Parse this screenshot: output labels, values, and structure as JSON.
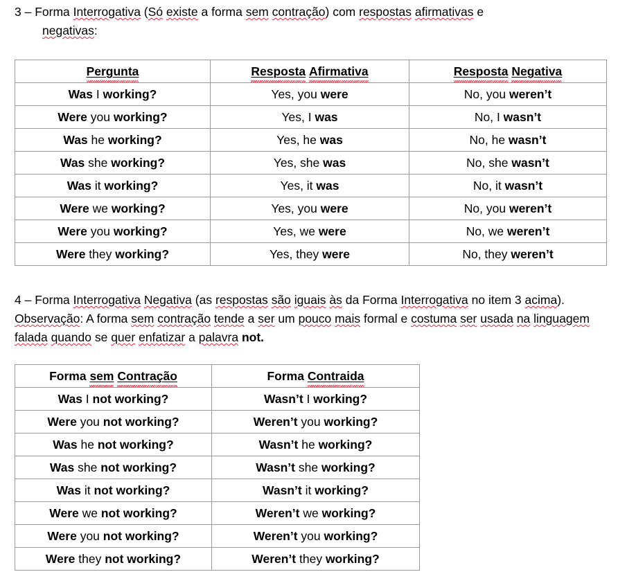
{
  "document": {
    "section3": {
      "number": "3",
      "dash": "–",
      "line1_part1": "Forma ",
      "line1_interrogativa": "Interrogativa",
      "line1_part2": " (",
      "line1_so": "Só",
      "line1_part3": " ",
      "line1_existe": "existe",
      "line1_part4": " a forma ",
      "line1_sem": "sem",
      "line1_part5": " ",
      "line1_contracao": "contração",
      "line1_part6": ") com ",
      "line1_respostas": "respostas",
      "line1_part7": " ",
      "line1_afirmativas": "afirmativas",
      "line1_part8": " e",
      "line2_negativas": "negativas",
      "line2_colon": ":"
    },
    "section4": {
      "number": "4",
      "dash": "–",
      "t1": "Forma ",
      "t2": "Interrogativa",
      "t3": " ",
      "t4": "Negativa",
      "t5": " (as ",
      "t6": "respostas",
      "t7": " ",
      "t8": "são",
      "t9": " ",
      "t10": "iguais",
      "t11": " ",
      "t12": "às",
      "t13": " da Forma ",
      "t14": "Interrogativa",
      "t15": " no item 3 ",
      "t16": "acima",
      "t17": "). ",
      "t18": "Observação",
      "t19": ": A forma ",
      "t20": "sem",
      "t21": " ",
      "t22": "contração",
      "t23": " ",
      "t24": "tende",
      "t25": " a ",
      "t26": "ser",
      "t27": " um ",
      "t28": "pouco",
      "t29": " ",
      "t30": "mais",
      "t31": " formal e ",
      "t32": "costuma",
      "t33": " ",
      "t34": "ser",
      "t35": " ",
      "t36": "usada",
      "t37": " ",
      "t38": "na",
      "t39": " ",
      "t40": "linguagem",
      "t41": " ",
      "t42": "falada",
      "t43": " ",
      "t44": "quando",
      "t45": " se ",
      "t46": "quer",
      "t47": " ",
      "t48": "enfatizar",
      "t49": " a ",
      "t50": "palavra",
      "t51": " ",
      "t52_bold": "not."
    }
  },
  "table_interrogative": {
    "headers": [
      {
        "word1": "Pergunta",
        "word2": ""
      },
      {
        "word1": "Resposta",
        "word2": "Afirmativa"
      },
      {
        "word1": "Resposta",
        "word2": "Negativa"
      }
    ],
    "rows": [
      {
        "q_bold": "Was",
        "q_mid": " I ",
        "q_tail_bold": "working?",
        "a_plain": "Yes, you ",
        "a_bold": "were",
        "n_plain": "No, you ",
        "n_bold": "weren’t"
      },
      {
        "q_bold": "Were",
        "q_mid": " you ",
        "q_tail_bold": "working?",
        "a_plain": "Yes, I ",
        "a_bold": "was",
        "n_plain": "No, I ",
        "n_bold": "wasn’t"
      },
      {
        "q_bold": "Was",
        "q_mid": " he ",
        "q_tail_bold": "working?",
        "a_plain": "Yes, he ",
        "a_bold": "was",
        "n_plain": "No, he ",
        "n_bold": "wasn’t"
      },
      {
        "q_bold": "Was",
        "q_mid": " she ",
        "q_tail_bold": "working?",
        "a_plain": "Yes, she ",
        "a_bold": "was",
        "n_plain": "No, she ",
        "n_bold": "wasn’t"
      },
      {
        "q_bold": "Was",
        "q_mid": " it ",
        "q_tail_bold": "working?",
        "a_plain": "Yes, it ",
        "a_bold": "was",
        "n_plain": "No, it ",
        "n_bold": "wasn’t"
      },
      {
        "q_bold": "Were",
        "q_mid": " we ",
        "q_tail_bold": "working?",
        "a_plain": "Yes, you ",
        "a_bold": "were",
        "n_plain": "No, you ",
        "n_bold": "weren’t"
      },
      {
        "q_bold": "Were",
        "q_mid": " you ",
        "q_tail_bold": "working?",
        "a_plain": "Yes, we ",
        "a_bold": "were",
        "n_plain": "No, we ",
        "n_bold": "weren’t"
      },
      {
        "q_bold": "Were",
        "q_mid": " they ",
        "q_tail_bold": "working?",
        "a_plain": "Yes, they ",
        "a_bold": "were",
        "n_plain": "No, they ",
        "n_bold": "weren’t"
      }
    ]
  },
  "table_negative_interrogative": {
    "headers": [
      {
        "plain1": "Forma ",
        "under1": "sem",
        "plain2": " ",
        "under2": "Contração"
      },
      {
        "plain1": "Forma ",
        "under1": "Contraida",
        "plain2": "",
        "under2": ""
      }
    ],
    "rows": [
      {
        "full_bold": "Was",
        "full_mid": " I ",
        "full_tail": "not working?",
        "contr_bold": "Wasn’t",
        "contr_mid": " I ",
        "contr_tail": "working?"
      },
      {
        "full_bold": "Were",
        "full_mid": " you ",
        "full_tail": "not working?",
        "contr_bold": "Weren’t",
        "contr_mid": " you ",
        "contr_tail": "working?"
      },
      {
        "full_bold": "Was",
        "full_mid": " he ",
        "full_tail": "not working?",
        "contr_bold": "Wasn’t",
        "contr_mid": " he ",
        "contr_tail": "working?"
      },
      {
        "full_bold": "Was",
        "full_mid": " she ",
        "full_tail": "not working?",
        "contr_bold": "Wasn’t",
        "contr_mid": " she ",
        "contr_tail": "working?"
      },
      {
        "full_bold": "Was",
        "full_mid": " it ",
        "full_tail": "not working?",
        "contr_bold": "Wasn’t",
        "contr_mid": " it ",
        "contr_tail": "working?"
      },
      {
        "full_bold": "Were",
        "full_mid": " we ",
        "full_tail": "not working?",
        "contr_bold": "Weren’t",
        "contr_mid": " we ",
        "contr_tail": "working?"
      },
      {
        "full_bold": "Were",
        "full_mid": " you ",
        "full_tail": "not working?",
        "contr_bold": "Weren’t",
        "contr_mid": " you ",
        "contr_tail": "working?"
      },
      {
        "full_bold": "Were",
        "full_mid": " they ",
        "full_tail": "not working?",
        "contr_bold": "Weren’t",
        "contr_mid": " they ",
        "contr_tail": "working?"
      }
    ]
  },
  "colors": {
    "spellcheck_underline": "#e8243c",
    "table_border": "#9a9a9a",
    "text": "#000000"
  }
}
